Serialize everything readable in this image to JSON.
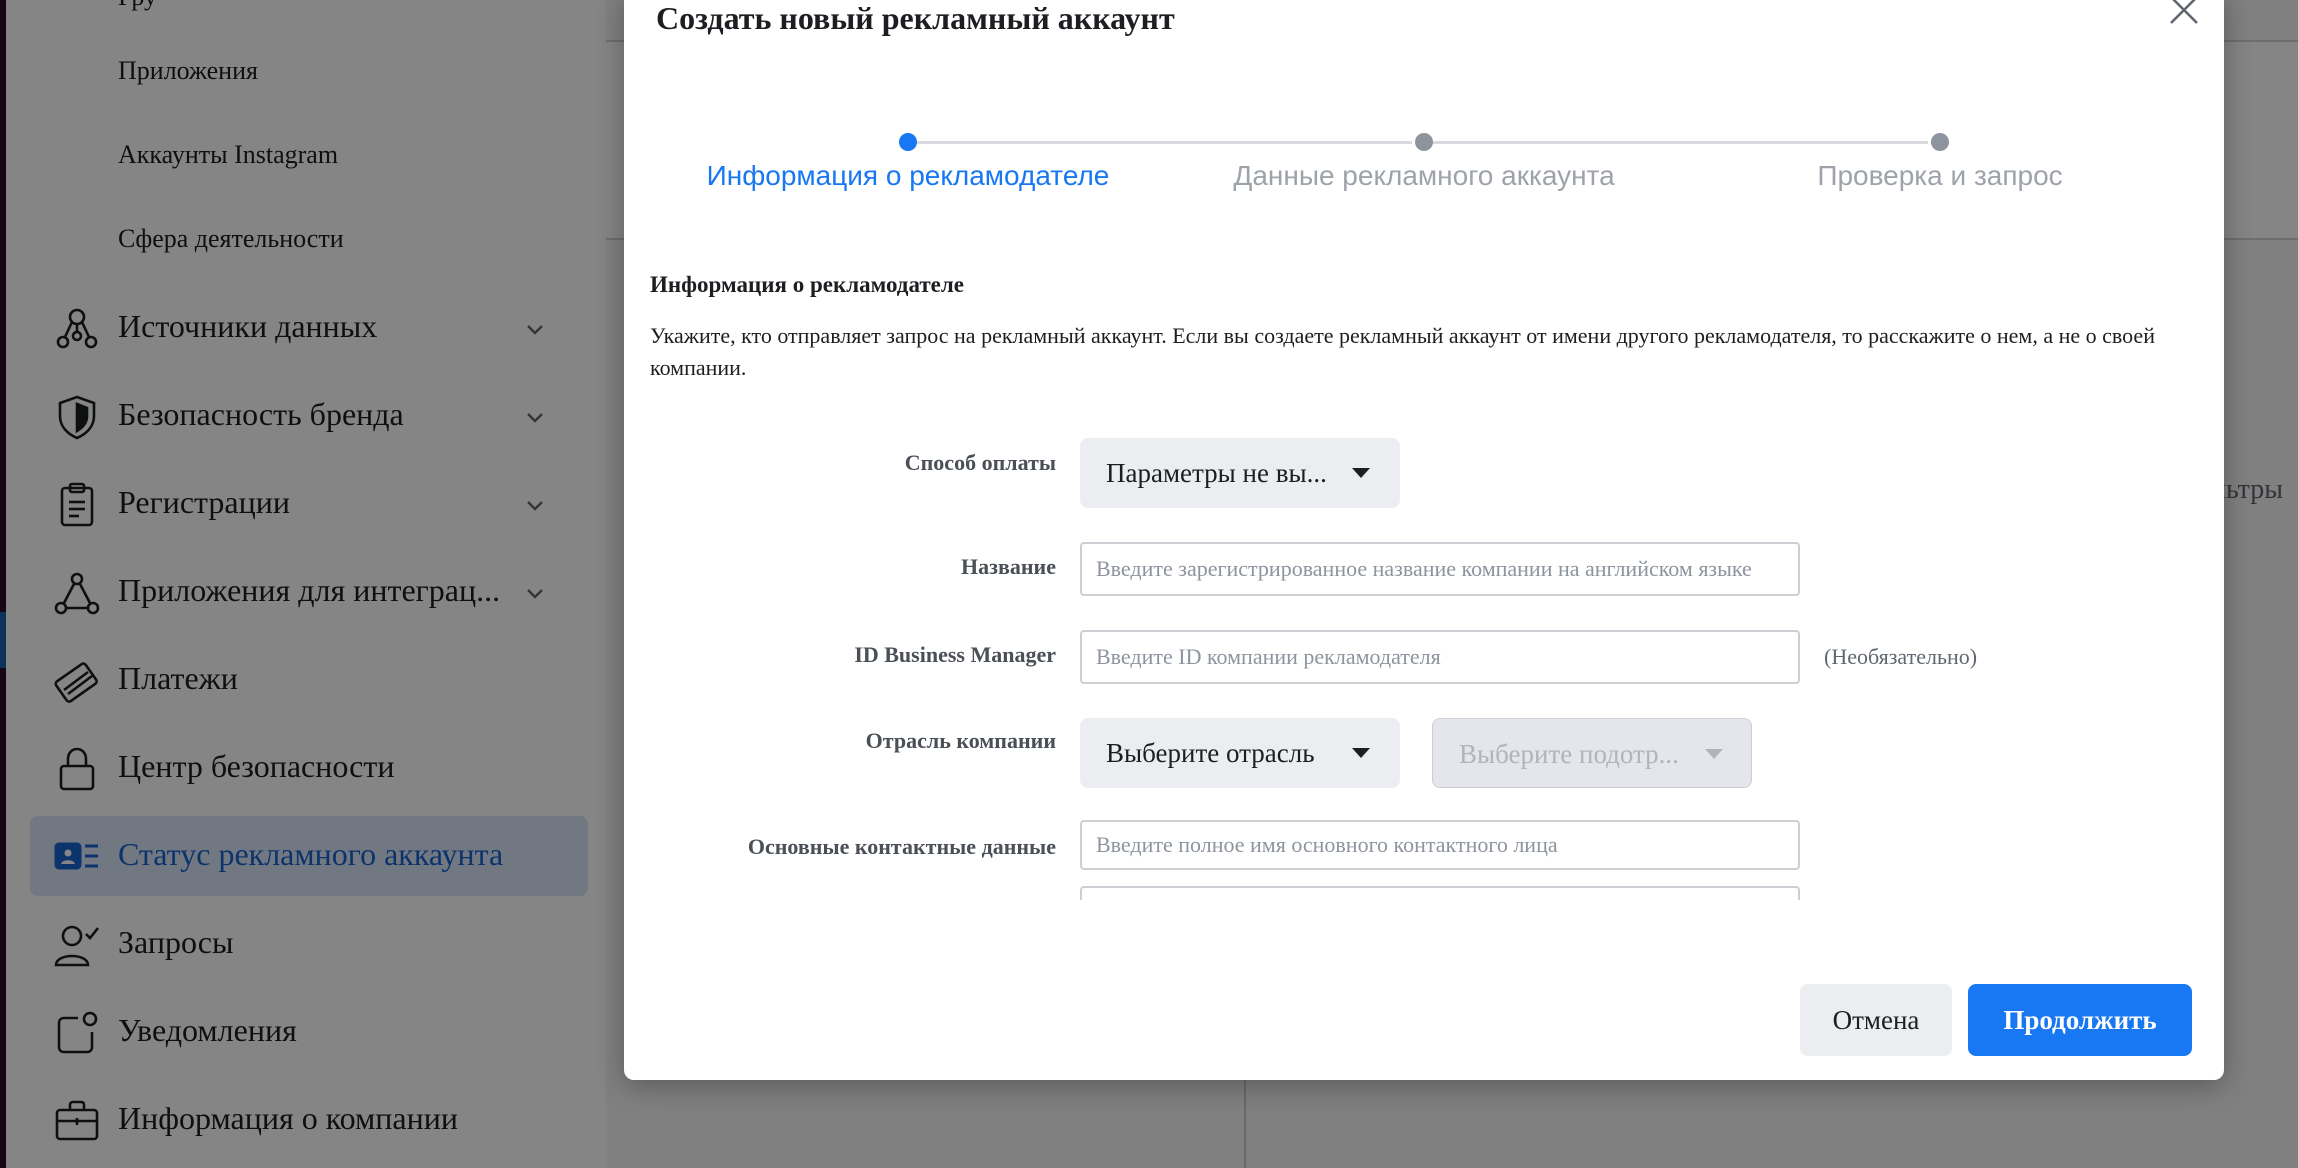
{
  "sidebar": {
    "sub_items": [
      "Приложения",
      "Аккаунты Instagram",
      "Сфера деятельности"
    ],
    "items": [
      {
        "label": "Источники данных",
        "icon": "data-sources-icon",
        "expandable": true
      },
      {
        "label": "Безопасность бренда",
        "icon": "shield-icon",
        "expandable": true
      },
      {
        "label": "Регистрации",
        "icon": "clipboard-icon",
        "expandable": true
      },
      {
        "label": "Приложения для интеграц...",
        "icon": "integration-icon",
        "expandable": true
      },
      {
        "label": "Платежи",
        "icon": "credit-card-icon",
        "expandable": false
      },
      {
        "label": "Центр безопасности",
        "icon": "lock-icon",
        "expandable": false
      },
      {
        "label": "Статус рекламного аккаунта",
        "icon": "ad-account-status-icon",
        "expandable": false,
        "active": true
      },
      {
        "label": "Запросы",
        "icon": "user-check-icon",
        "expandable": false
      },
      {
        "label": "Уведомления",
        "icon": "notification-icon",
        "expandable": false
      },
      {
        "label": "Информация о компании",
        "icon": "briefcase-icon",
        "expandable": false
      }
    ]
  },
  "background": {
    "partial_text": "льтры"
  },
  "modal": {
    "title": "Создать новый рекламный аккаунт",
    "steps": [
      {
        "label": "Информация о рекламодателе",
        "active": true
      },
      {
        "label": "Данные рекламного аккаунта",
        "active": false
      },
      {
        "label": "Проверка и запрос",
        "active": false
      }
    ],
    "section_title": "Информация о рекламодателе",
    "section_description": "Укажите, кто отправляет запрос на рекламный аккаунт. Если вы создаете рекламный аккаунт от имени другого рекламодателя, то расскажите о нем, а не о своей компании.",
    "fields": {
      "payment_method": {
        "label": "Способ оплаты",
        "value": "Параметры не вы..."
      },
      "name": {
        "label": "Название",
        "placeholder": "Введите зарегистрированное название компании на английском языке"
      },
      "business_manager_id": {
        "label": "ID Business Manager",
        "placeholder": "Введите ID компании рекламодателя",
        "note": "(Необязательно)"
      },
      "industry": {
        "label": "Отрасль компании",
        "value": "Выберите отрасль",
        "sub_value": "Выберите подотр..."
      },
      "primary_contact": {
        "label": "Основные контактные данные",
        "placeholder": "Введите полное имя основного контактного лица"
      }
    },
    "buttons": {
      "cancel": "Отмена",
      "continue": "Продолжить"
    }
  },
  "colors": {
    "accent": "#1877f2",
    "active_nav_bg": "#dbe6f7",
    "active_nav_text": "#1763cf"
  }
}
